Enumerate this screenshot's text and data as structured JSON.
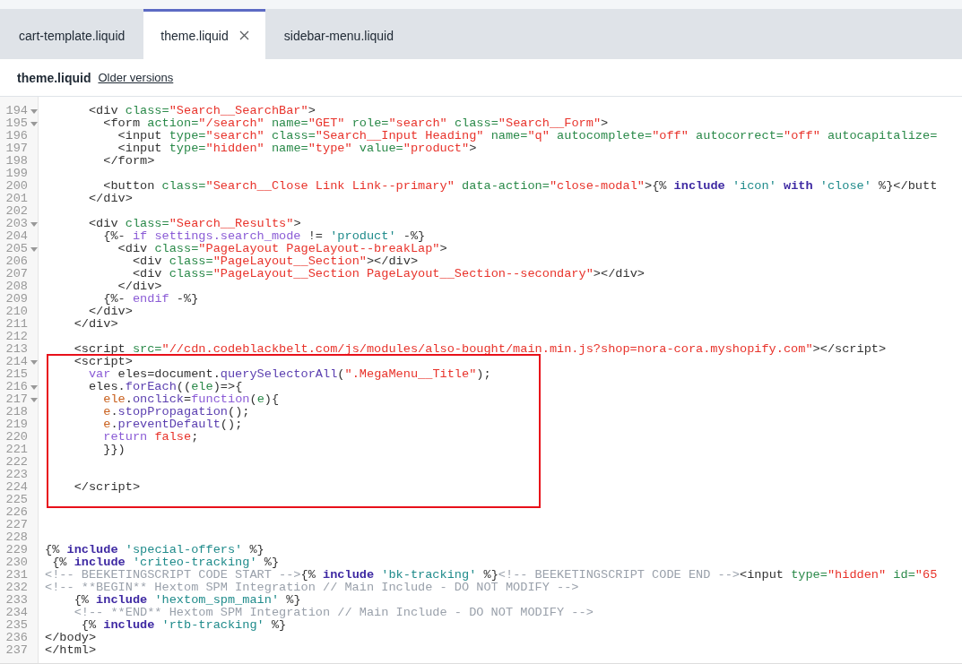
{
  "tabs": [
    {
      "label": "cart-template.liquid",
      "selected": false,
      "closable": false
    },
    {
      "label": "theme.liquid",
      "selected": true,
      "closable": true
    },
    {
      "label": "sidebar-menu.liquid",
      "selected": false,
      "closable": false
    }
  ],
  "file_header": {
    "title": "theme.liquid",
    "link": "Older versions"
  },
  "editor": {
    "sections": [
      {
        "highlighted": false,
        "lines": [
          {
            "number": "194",
            "foldable": true,
            "tokens": [
              {
                "kind": "plain",
                "text": "      <div"
              },
              {
                "kind": "attr",
                "text": " class="
              },
              {
                "kind": "str",
                "text": "\"Search__SearchBar\""
              },
              {
                "kind": "plain",
                "text": ">"
              }
            ]
          },
          {
            "number": "195",
            "foldable": true,
            "tokens": [
              {
                "kind": "plain",
                "text": "        <form"
              },
              {
                "kind": "attr",
                "text": " action="
              },
              {
                "kind": "str",
                "text": "\"/search\""
              },
              {
                "kind": "attr",
                "text": " name="
              },
              {
                "kind": "str",
                "text": "\"GET\""
              },
              {
                "kind": "attr",
                "text": " role="
              },
              {
                "kind": "str",
                "text": "\"search\""
              },
              {
                "kind": "attr",
                "text": " class="
              },
              {
                "kind": "str",
                "text": "\"Search__Form\""
              },
              {
                "kind": "plain",
                "text": ">"
              }
            ]
          },
          {
            "number": "196",
            "foldable": false,
            "tokens": [
              {
                "kind": "plain",
                "text": "          <input"
              },
              {
                "kind": "attr",
                "text": " type="
              },
              {
                "kind": "str",
                "text": "\"search\""
              },
              {
                "kind": "attr",
                "text": " class="
              },
              {
                "kind": "str",
                "text": "\"Search__Input Heading\""
              },
              {
                "kind": "attr",
                "text": " name="
              },
              {
                "kind": "str",
                "text": "\"q\""
              },
              {
                "kind": "attr",
                "text": " autocomplete="
              },
              {
                "kind": "str",
                "text": "\"off\""
              },
              {
                "kind": "attr",
                "text": " autocorrect="
              },
              {
                "kind": "str",
                "text": "\"off\""
              },
              {
                "kind": "attr",
                "text": " autocapitalize="
              }
            ]
          },
          {
            "number": "197",
            "foldable": false,
            "tokens": [
              {
                "kind": "plain",
                "text": "          <input"
              },
              {
                "kind": "attr",
                "text": " type="
              },
              {
                "kind": "str",
                "text": "\"hidden\""
              },
              {
                "kind": "attr",
                "text": " name="
              },
              {
                "kind": "str",
                "text": "\"type\""
              },
              {
                "kind": "attr",
                "text": " value="
              },
              {
                "kind": "str",
                "text": "\"product\""
              },
              {
                "kind": "plain",
                "text": ">"
              }
            ]
          },
          {
            "number": "198",
            "foldable": false,
            "tokens": [
              {
                "kind": "plain",
                "text": "        </form>"
              }
            ]
          },
          {
            "number": "199",
            "foldable": false
          },
          {
            "number": "200",
            "foldable": false,
            "tokens": [
              {
                "kind": "plain",
                "text": "        <button"
              },
              {
                "kind": "attr",
                "text": " class="
              },
              {
                "kind": "str",
                "text": "\"Search__Close Link Link--primary\""
              },
              {
                "kind": "attr",
                "text": " data-action="
              },
              {
                "kind": "str",
                "text": "\"close-modal\""
              },
              {
                "kind": "plain",
                "text": ">{% "
              },
              {
                "kind": "kw",
                "text": "include"
              },
              {
                "kind": "lstr",
                "text": " 'icon'"
              },
              {
                "kind": "kw",
                "text": " with"
              },
              {
                "kind": "lstr",
                "text": " 'close'"
              },
              {
                "kind": "plain",
                "text": " %}</butt"
              }
            ]
          },
          {
            "number": "201",
            "foldable": false,
            "tokens": [
              {
                "kind": "plain",
                "text": "      </div>"
              }
            ]
          },
          {
            "number": "202",
            "foldable": false
          },
          {
            "number": "203",
            "foldable": true,
            "tokens": [
              {
                "kind": "plain",
                "text": "      <div"
              },
              {
                "kind": "attr",
                "text": " class="
              },
              {
                "kind": "str",
                "text": "\"Search__Results\""
              },
              {
                "kind": "plain",
                "text": ">"
              }
            ]
          },
          {
            "number": "204",
            "foldable": false,
            "tokens": [
              {
                "kind": "plain",
                "text": "        {%- "
              },
              {
                "kind": "var",
                "text": "if settings.search_mode"
              },
              {
                "kind": "plain",
                "text": " != "
              },
              {
                "kind": "lstr",
                "text": "'product'"
              },
              {
                "kind": "plain",
                "text": " -%}"
              }
            ]
          },
          {
            "number": "205",
            "foldable": true,
            "tokens": [
              {
                "kind": "plain",
                "text": "          <div"
              },
              {
                "kind": "attr",
                "text": " class="
              },
              {
                "kind": "str",
                "text": "\"PageLayout PageLayout--breakLap\""
              },
              {
                "kind": "plain",
                "text": ">"
              }
            ]
          },
          {
            "number": "206",
            "foldable": false,
            "tokens": [
              {
                "kind": "plain",
                "text": "            <div"
              },
              {
                "kind": "attr",
                "text": " class="
              },
              {
                "kind": "str",
                "text": "\"PageLayout__Section\""
              },
              {
                "kind": "plain",
                "text": "></div>"
              }
            ]
          },
          {
            "number": "207",
            "foldable": false,
            "tokens": [
              {
                "kind": "plain",
                "text": "            <div"
              },
              {
                "kind": "attr",
                "text": " class="
              },
              {
                "kind": "str",
                "text": "\"PageLayout__Section PageLayout__Section--secondary\""
              },
              {
                "kind": "plain",
                "text": "></div>"
              }
            ]
          },
          {
            "number": "208",
            "foldable": false,
            "tokens": [
              {
                "kind": "plain",
                "text": "          </div>"
              }
            ]
          },
          {
            "number": "209",
            "foldable": false,
            "tokens": [
              {
                "kind": "plain",
                "text": "        {%- "
              },
              {
                "kind": "var",
                "text": "endif"
              },
              {
                "kind": "plain",
                "text": " -%}"
              }
            ]
          },
          {
            "number": "210",
            "foldable": false,
            "tokens": [
              {
                "kind": "plain",
                "text": "      </div>"
              }
            ]
          },
          {
            "number": "211",
            "foldable": false,
            "tokens": [
              {
                "kind": "plain",
                "text": "    </div>"
              }
            ]
          },
          {
            "number": "212",
            "foldable": false
          },
          {
            "number": "213",
            "foldable": false,
            "tokens": [
              {
                "kind": "plain",
                "text": "    <script"
              },
              {
                "kind": "attr",
                "text": " src="
              },
              {
                "kind": "str",
                "text": "\"//cdn.codeblackbelt.com/js/modules/also-bought/main.min.js?shop=nora-cora.myshopify.com\""
              },
              {
                "kind": "plain",
                "text": "></script>"
              }
            ]
          }
        ]
      },
      {
        "highlighted": true,
        "lines": [
          {
            "number": "214",
            "foldable": true,
            "tokens": [
              {
                "kind": "plain",
                "text": "    <script>"
              }
            ]
          },
          {
            "number": "215",
            "foldable": false,
            "tokens": [
              {
                "kind": "var",
                "text": "      var"
              },
              {
                "kind": "plain",
                "text": " eles=document."
              },
              {
                "kind": "fn",
                "text": "querySelectorAll"
              },
              {
                "kind": "plain",
                "text": "("
              },
              {
                "kind": "str",
                "text": "\".MegaMenu__Title\""
              },
              {
                "kind": "plain",
                "text": ");"
              }
            ]
          },
          {
            "number": "216",
            "foldable": true,
            "tokens": [
              {
                "kind": "plain",
                "text": "      eles."
              },
              {
                "kind": "fn",
                "text": "forEach"
              },
              {
                "kind": "plain",
                "text": "(("
              },
              {
                "kind": "arg",
                "text": "ele"
              },
              {
                "kind": "plain",
                "text": ")=>{"
              }
            ]
          },
          {
            "number": "217",
            "foldable": true,
            "tokens": [
              {
                "kind": "prop",
                "text": "        ele"
              },
              {
                "kind": "plain",
                "text": "."
              },
              {
                "kind": "fn",
                "text": "onclick"
              },
              {
                "kind": "plain",
                "text": "="
              },
              {
                "kind": "var",
                "text": "function"
              },
              {
                "kind": "plain",
                "text": "("
              },
              {
                "kind": "arg",
                "text": "e"
              },
              {
                "kind": "plain",
                "text": "){"
              }
            ]
          },
          {
            "number": "218",
            "foldable": false,
            "tokens": [
              {
                "kind": "prop",
                "text": "        e"
              },
              {
                "kind": "plain",
                "text": "."
              },
              {
                "kind": "fn",
                "text": "stopPropagation"
              },
              {
                "kind": "plain",
                "text": "();"
              }
            ]
          },
          {
            "number": "219",
            "foldable": false,
            "tokens": [
              {
                "kind": "prop",
                "text": "        e"
              },
              {
                "kind": "plain",
                "text": "."
              },
              {
                "kind": "fn",
                "text": "preventDefault"
              },
              {
                "kind": "plain",
                "text": "();"
              }
            ]
          },
          {
            "number": "220",
            "foldable": false,
            "tokens": [
              {
                "kind": "var",
                "text": "        return"
              },
              {
                "kind": "str",
                "text": " false"
              },
              {
                "kind": "plain",
                "text": ";"
              }
            ]
          },
          {
            "number": "221",
            "foldable": false,
            "tokens": [
              {
                "kind": "plain",
                "text": "        }})"
              }
            ]
          },
          {
            "number": "222",
            "foldable": false
          },
          {
            "number": "223",
            "foldable": false
          },
          {
            "number": "224",
            "foldable": false,
            "tokens": [
              {
                "kind": "plain",
                "text": "    </script>"
              }
            ]
          },
          {
            "number": "225",
            "foldable": false
          }
        ]
      },
      {
        "highlighted": false,
        "lines": [
          {
            "number": "226",
            "foldable": false
          },
          {
            "number": "227",
            "foldable": false
          },
          {
            "number": "228",
            "foldable": false
          },
          {
            "number": "229",
            "foldable": false,
            "tokens": [
              {
                "kind": "plain",
                "text": "{% "
              },
              {
                "kind": "kw",
                "text": "include"
              },
              {
                "kind": "lstr",
                "text": " 'special-offers'"
              },
              {
                "kind": "plain",
                "text": " %}"
              }
            ]
          },
          {
            "number": "230",
            "foldable": false,
            "tokens": [
              {
                "kind": "plain",
                "text": " {% "
              },
              {
                "kind": "kw",
                "text": "include"
              },
              {
                "kind": "lstr",
                "text": " 'criteo-tracking'"
              },
              {
                "kind": "plain",
                "text": " %}"
              }
            ]
          },
          {
            "number": "231",
            "foldable": false,
            "tokens": [
              {
                "kind": "com",
                "text": "<!-- BEEKETINGSCRIPT CODE START -->"
              },
              {
                "kind": "plain",
                "text": "{% "
              },
              {
                "kind": "kw",
                "text": "include"
              },
              {
                "kind": "lstr",
                "text": " 'bk-tracking'"
              },
              {
                "kind": "plain",
                "text": " %}"
              },
              {
                "kind": "com",
                "text": "<!-- BEEKETINGSCRIPT CODE END -->"
              },
              {
                "kind": "plain",
                "text": "<input"
              },
              {
                "kind": "attr",
                "text": " type="
              },
              {
                "kind": "str",
                "text": "\"hidden\""
              },
              {
                "kind": "attr",
                "text": " id="
              },
              {
                "kind": "str",
                "text": "\"65"
              }
            ]
          },
          {
            "number": "232",
            "foldable": false,
            "tokens": [
              {
                "kind": "com",
                "text": "<!-- **BEGIN** Hextom SPM Integration // Main Include - DO NOT MODIFY -->"
              }
            ]
          },
          {
            "number": "233",
            "foldable": false,
            "tokens": [
              {
                "kind": "plain",
                "text": "    {% "
              },
              {
                "kind": "kw",
                "text": "include"
              },
              {
                "kind": "lstr",
                "text": " 'hextom_spm_main'"
              },
              {
                "kind": "plain",
                "text": " %}"
              }
            ]
          },
          {
            "number": "234",
            "foldable": false,
            "tokens": [
              {
                "kind": "com",
                "text": "    <!-- **END** Hextom SPM Integration // Main Include - DO NOT MODIFY -->"
              }
            ]
          },
          {
            "number": "235",
            "foldable": false,
            "tokens": [
              {
                "kind": "plain",
                "text": "     {% "
              },
              {
                "kind": "kw",
                "text": "include"
              },
              {
                "kind": "lstr",
                "text": " 'rtb-tracking'"
              },
              {
                "kind": "plain",
                "text": " %}"
              }
            ]
          },
          {
            "number": "236",
            "foldable": false,
            "tokens": [
              {
                "kind": "plain",
                "text": "</body>"
              }
            ]
          },
          {
            "number": "237",
            "foldable": false,
            "tokens": [
              {
                "kind": "plain",
                "text": "</html>"
              }
            ]
          }
        ]
      }
    ]
  }
}
